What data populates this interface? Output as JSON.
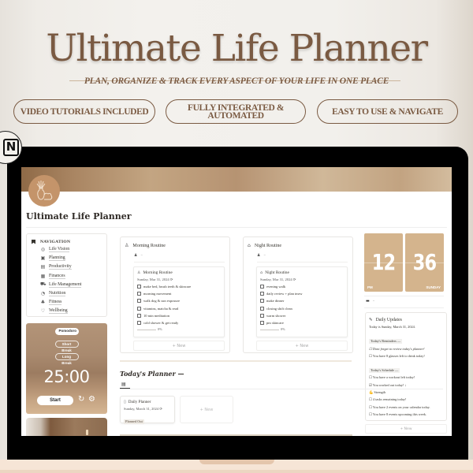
{
  "hero": {
    "title": "Ultimate Life Planner",
    "subtitle": "PLAN, ORGANIZE & TRACK EVERY ASPECT OF YOUR LIFE IN ONE PLACE",
    "features": [
      "VIDEO TUTORIALS INCLUDED",
      "FULLY INTEGRATED & AUTOMATED",
      "EASY TO USE & NAVIGATE"
    ],
    "badge_icon": "notion-logo-icon",
    "badge_letter": "N"
  },
  "colors": {
    "brand_brown": "#7a5a42",
    "tan": "#d4b48d",
    "page_bg": "#f2f0ec"
  },
  "page": {
    "title": "Ultimate Life Planner",
    "icon": "vase-plant-icon"
  },
  "navigation": {
    "heading": "NAVIGATION",
    "items": [
      {
        "label": "Life Vision",
        "icon": "compass-icon"
      },
      {
        "label": "Planning",
        "icon": "calendar-icon"
      },
      {
        "label": "Productivity",
        "icon": "list-icon"
      },
      {
        "label": "Finances",
        "icon": "money-icon"
      },
      {
        "label": "Life Management",
        "icon": "car-icon"
      },
      {
        "label": "Nutrition",
        "icon": "food-icon"
      },
      {
        "label": "Fitness",
        "icon": "fitness-icon"
      },
      {
        "label": "Wellbeing",
        "icon": "heart-icon"
      }
    ]
  },
  "pomodoro": {
    "modes": [
      "Pomodoro",
      "Short Break",
      "Long Break"
    ],
    "time": "25:00",
    "start_label": "Start",
    "reset_icon": "↻",
    "settings_icon": "⚙"
  },
  "morning": {
    "title": "Morning Routine",
    "person_placeholder": "–",
    "entry": {
      "title": "Morning Routine",
      "date": "Sunday, Mar 31, 2024 ⟳",
      "tasks": [
        "make bed, brush teeth & skincare",
        "morning movement",
        "walk dog & sun exposure",
        "vitamins, matcha & read",
        "10 min meditation",
        "cold shower & get ready"
      ],
      "progress": "0%"
    },
    "new_label": "+ New"
  },
  "night": {
    "title": "Night Routine",
    "person_placeholder": "–",
    "entry": {
      "title": "Night Routine",
      "date": "Sunday, Mar 31, 2024 ⟳",
      "tasks": [
        "evening walk",
        "daily review + plan tmrw",
        "make dinner",
        "closing shift clean",
        "warm shower",
        "pm skincare"
      ],
      "progress": "0%"
    },
    "new_label": "+ New"
  },
  "clock": {
    "hour": "12",
    "minute": "36",
    "period": "PM",
    "day": "SUNDAY"
  },
  "calendar_row": {
    "placeholder": "–"
  },
  "daily_updates": {
    "title": "Daily Updates",
    "today": "Today is Sunday, March 31, 2024.",
    "reminders_heading": "Today's Reminders —",
    "reminders": [
      "☐ Dont forget to review today's planner!",
      "☐ You have 8 glasses left to drink today!"
    ],
    "schedule_heading": "Today's Schedule —",
    "schedule": [
      "☐ You have a workout left today!",
      "☑ You worked out today! ↓",
      "💪 Strength",
      "☐ 4 tasks remaining today!",
      "☐ You have 2 events on your calendar today.",
      "☐ You have 8 events upcoming this week."
    ],
    "new_label": "+ New"
  },
  "todays_planner": {
    "title": "Today's Planner —",
    "tab_icon": "▤",
    "card": {
      "title": "Daily Planner",
      "date": "Sunday, March 31, 2024 ⟳",
      "status": "Planned Out"
    },
    "new_label": "+ New"
  }
}
